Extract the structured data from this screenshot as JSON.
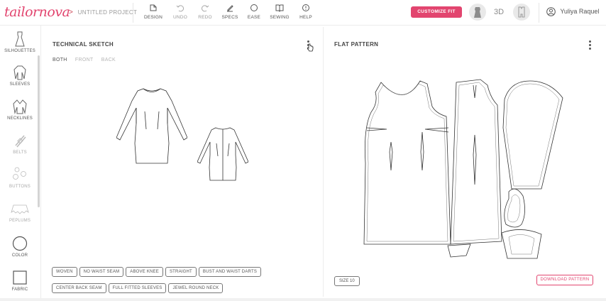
{
  "app": {
    "logo": "tailornova",
    "project": "UNTITLED PROJECT",
    "breadcrumb_sep": ">"
  },
  "toolbar": {
    "items": [
      {
        "label": "DESIGN",
        "icon": "design-icon"
      },
      {
        "label": "UNDO",
        "icon": "undo-icon"
      },
      {
        "label": "REDO",
        "icon": "redo-icon"
      },
      {
        "label": "SPECS",
        "icon": "specs-icon"
      },
      {
        "label": "EASE",
        "icon": "ease-icon"
      },
      {
        "label": "SEWING",
        "icon": "sewing-icon"
      },
      {
        "label": "HELP",
        "icon": "help-icon"
      }
    ],
    "customize_fit": "CUSTOMIZE FIT",
    "three_d": "3D",
    "user_name": "Yuliya Raquel"
  },
  "sidebar": {
    "items": [
      {
        "label": "SILHOUETTES",
        "icon": "silhouette-icon"
      },
      {
        "label": "SLEEVES",
        "icon": "sleeves-icon"
      },
      {
        "label": "NECKLINES",
        "icon": "necklines-icon"
      },
      {
        "label": "BELTS",
        "icon": "belts-icon"
      },
      {
        "label": "BUTTONS",
        "icon": "buttons-icon"
      },
      {
        "label": "PEPLUMS",
        "icon": "peplums-icon"
      },
      {
        "label": "COLOR",
        "icon": "color-icon"
      },
      {
        "label": "FABRIC",
        "icon": "fabric-icon"
      }
    ]
  },
  "technical_sketch": {
    "title": "TECHNICAL SKETCH",
    "tabs": [
      "BOTH",
      "FRONT",
      "BACK"
    ],
    "active_tab": "BOTH",
    "tags": [
      "WOVEN",
      "NO WAIST SEAM",
      "ABOVE KNEE",
      "STRAIGHT",
      "BUST AND WAIST DARTS",
      "CENTER BACK SEAM",
      "FULL FITTED SLEEVES",
      "JEWEL ROUND NECK"
    ]
  },
  "flat_pattern": {
    "title": "FLAT PATTERN",
    "size": "SIZE 10",
    "download": "DOWNLOAD PATTERN"
  },
  "colors": {
    "accent": "#e2456f"
  }
}
